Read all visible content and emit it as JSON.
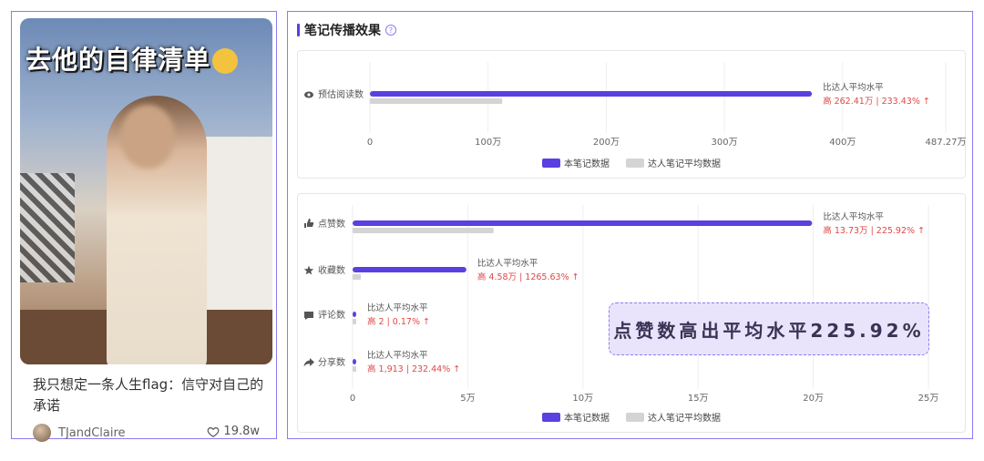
{
  "note": {
    "cover_title": "去他的自律清单",
    "title": "我只想定一条人生flag：信守对自己的承诺",
    "author": "TJandClaire",
    "likes": "19.8w"
  },
  "panel": {
    "title": "笔记传播效果"
  },
  "legend": {
    "own": "本笔记数据",
    "avg": "达人笔记平均数据"
  },
  "colors": {
    "own": "#5b3fe0",
    "avg": "#d4d4d4",
    "up": "#e04848"
  },
  "highlight": "点赞数高出平均水平225.92%",
  "chart_data": [
    {
      "type": "bar",
      "orientation": "horizontal",
      "categories": [
        "预估阅读数"
      ],
      "icons": [
        "eye-icon"
      ],
      "series": [
        {
          "name": "本笔记数据",
          "values": [
            3740000
          ]
        },
        {
          "name": "达人笔记平均数据",
          "values": [
            1120000
          ]
        }
      ],
      "annotations": [
        {
          "line1": "比达人平均水平",
          "line2": "高 262.41万 | 233.43% ↑"
        }
      ],
      "xticks": [
        "0",
        "100万",
        "200万",
        "300万",
        "400万",
        "487.27万"
      ],
      "xtick_values": [
        0,
        1000000,
        2000000,
        3000000,
        4000000,
        4872700
      ],
      "xlim": [
        0,
        4872700
      ],
      "legend": "bottom"
    },
    {
      "type": "bar",
      "orientation": "horizontal",
      "categories": [
        "点赞数",
        "收藏数",
        "评论数",
        "分享数"
      ],
      "icons": [
        "thumb-up-icon",
        "star-icon",
        "comment-icon",
        "share-icon"
      ],
      "series": [
        {
          "name": "本笔记数据",
          "values": [
            199500,
            49400,
            1200,
            1000
          ]
        },
        {
          "name": "达人笔记平均数据",
          "values": [
            61200,
            3600,
            1000,
            800
          ]
        }
      ],
      "annotations": [
        {
          "line1": "比达人平均水平",
          "line2": "高 13.73万 | 225.92% ↑"
        },
        {
          "line1": "比达人平均水平",
          "line2": "高 4.58万 | 1265.63% ↑"
        },
        {
          "line1": "比达人平均水平",
          "line2": "高 2 | 0.17% ↑"
        },
        {
          "line1": "比达人平均水平",
          "line2": "高 1,913 | 232.44% ↑"
        }
      ],
      "xticks": [
        "0",
        "5万",
        "10万",
        "15万",
        "20万",
        "25万"
      ],
      "xtick_values": [
        0,
        50000,
        100000,
        150000,
        200000,
        250000
      ],
      "xlim": [
        0,
        250000
      ],
      "legend": "bottom"
    }
  ]
}
